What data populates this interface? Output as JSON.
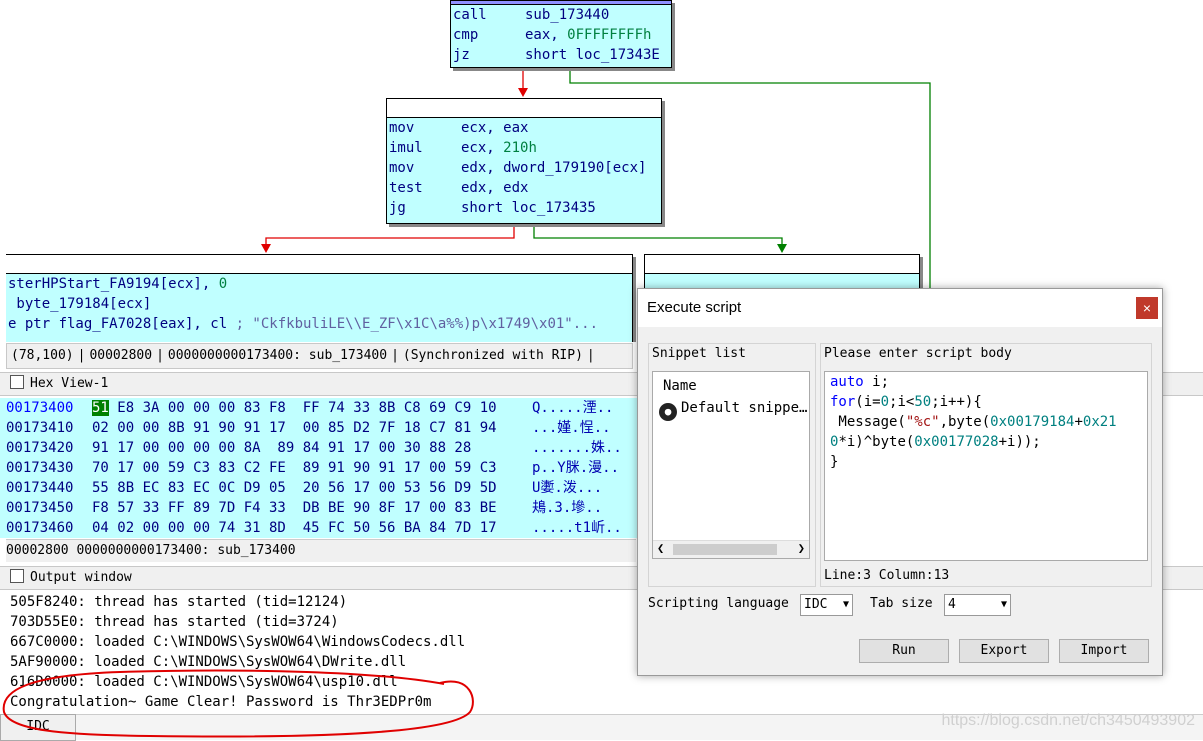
{
  "graph": {
    "top_node": [
      {
        "mnem": "call",
        "op": "sub_173440"
      },
      {
        "mnem": "cmp",
        "op": "eax, ",
        "num": "0FFFFFFFFh"
      },
      {
        "mnem": "jz",
        "op": "short loc_17343E"
      }
    ],
    "mid_node": [
      {
        "mnem": "mov",
        "op": "ecx, eax"
      },
      {
        "mnem": "imul",
        "op": "ecx, ",
        "num": "210h"
      },
      {
        "mnem": "mov",
        "op": "edx, dword_179190[ecx]"
      },
      {
        "mnem": "test",
        "op": "edx, edx"
      },
      {
        "mnem": "jg",
        "op": "short loc_173435"
      }
    ],
    "left_node": [
      {
        "text": "sterHPStart_FA9194[ecx], ",
        "num": "0"
      },
      {
        "text": " byte_179184[ecx]"
      },
      {
        "text": "e ptr flag_FA7028[eax], cl ",
        "cmt": "; \"CkfkbuliLE\\\\E_ZF\\x1C\\a%%)p\\x1749\\x01\"..."
      }
    ],
    "status": [
      "(78,100)",
      "00002800",
      "0000000000173400: sub_173400",
      "(Synchronized with RIP)"
    ]
  },
  "hex": {
    "title": "Hex View-1",
    "rows": [
      {
        "addr": "00173400",
        "first": "51",
        "bytes": " E8 3A 00 00 00 83 F8  FF 74 33 8B C8 69 C9 10",
        "ascii": "Q.....湮.."
      },
      {
        "addr": "00173410",
        "first": "",
        "bytes": "02 00 00 8B 91 90 91 17  00 85 D2 7F 18 C7 81 94",
        "ascii": "...嫤.悜.."
      },
      {
        "addr": "00173420",
        "first": "",
        "bytes": "91 17 00 00 00 00 8A  89 84 91 17 00 30 88 28",
        "ascii": ".......姝.."
      },
      {
        "addr": "00173430",
        "first": "",
        "bytes": "70 17 00 59 C3 83 C2 FE  89 91 90 91 17 00 59 C3",
        "ascii": "p..Y脒.漫.."
      },
      {
        "addr": "00173440",
        "first": "",
        "bytes": "55 8B EC 83 EC 0C D9 05  20 56 17 00 53 56 D9 5D",
        "ascii": "U嬱.泼..."
      },
      {
        "addr": "00173450",
        "first": "",
        "bytes": "F8 57 33 FF 89 7D F4 33  DB BE 90 8F 17 00 83 BE",
        "ascii": "鳺.3.墋.."
      },
      {
        "addr": "00173460",
        "first": "",
        "bytes": "04 02 00 00 00 74 31 8D  45 FC 50 56 BA 84 7D 17",
        "ascii": ".....t1岓.."
      }
    ],
    "status": "00002800 0000000000173400: sub_173400"
  },
  "output": {
    "title": "Output window",
    "lines": [
      "505F8240: thread has started (tid=12124)",
      "703D55E0: thread has started (tid=3724)",
      "667C0000: loaded C:\\WINDOWS\\SysWOW64\\WindowsCodecs.dll",
      "5AF90000: loaded C:\\WINDOWS\\SysWOW64\\DWrite.dll",
      "616D0000: loaded C:\\WINDOWS\\SysWOW64\\usp10.dll",
      "Congratulation~ Game Clear! Password is Thr3EDPr0m"
    ],
    "idc_label": "IDC"
  },
  "dialog": {
    "title": "Execute script",
    "close": "×",
    "snippet_list_label": "Snippet list",
    "snippet_name_header": "Name",
    "snippet_item": "Default snippe…",
    "script_body_label": "Please enter script body",
    "code_lines": [
      "auto i;",
      "for(i=0;i<50;i++){",
      " Message(\"%c\",byte(0x00179184+0x21",
      "0*i)^byte(0x00177028+i));",
      "}"
    ],
    "line_col": "Line:3  Column:13",
    "scripting_language_label": "Scripting language",
    "scripting_language_value": "IDC",
    "tab_size_label": "Tab size",
    "tab_size_value": "4",
    "run": "Run",
    "export": "Export",
    "import": "Import"
  },
  "watermark": "https://blog.csdn.net/ch3450493902",
  "colors": {
    "node_bg": "#c0ffff",
    "edge_red": "#e00000",
    "edge_green": "#008000",
    "circle_red": "#e00000"
  }
}
